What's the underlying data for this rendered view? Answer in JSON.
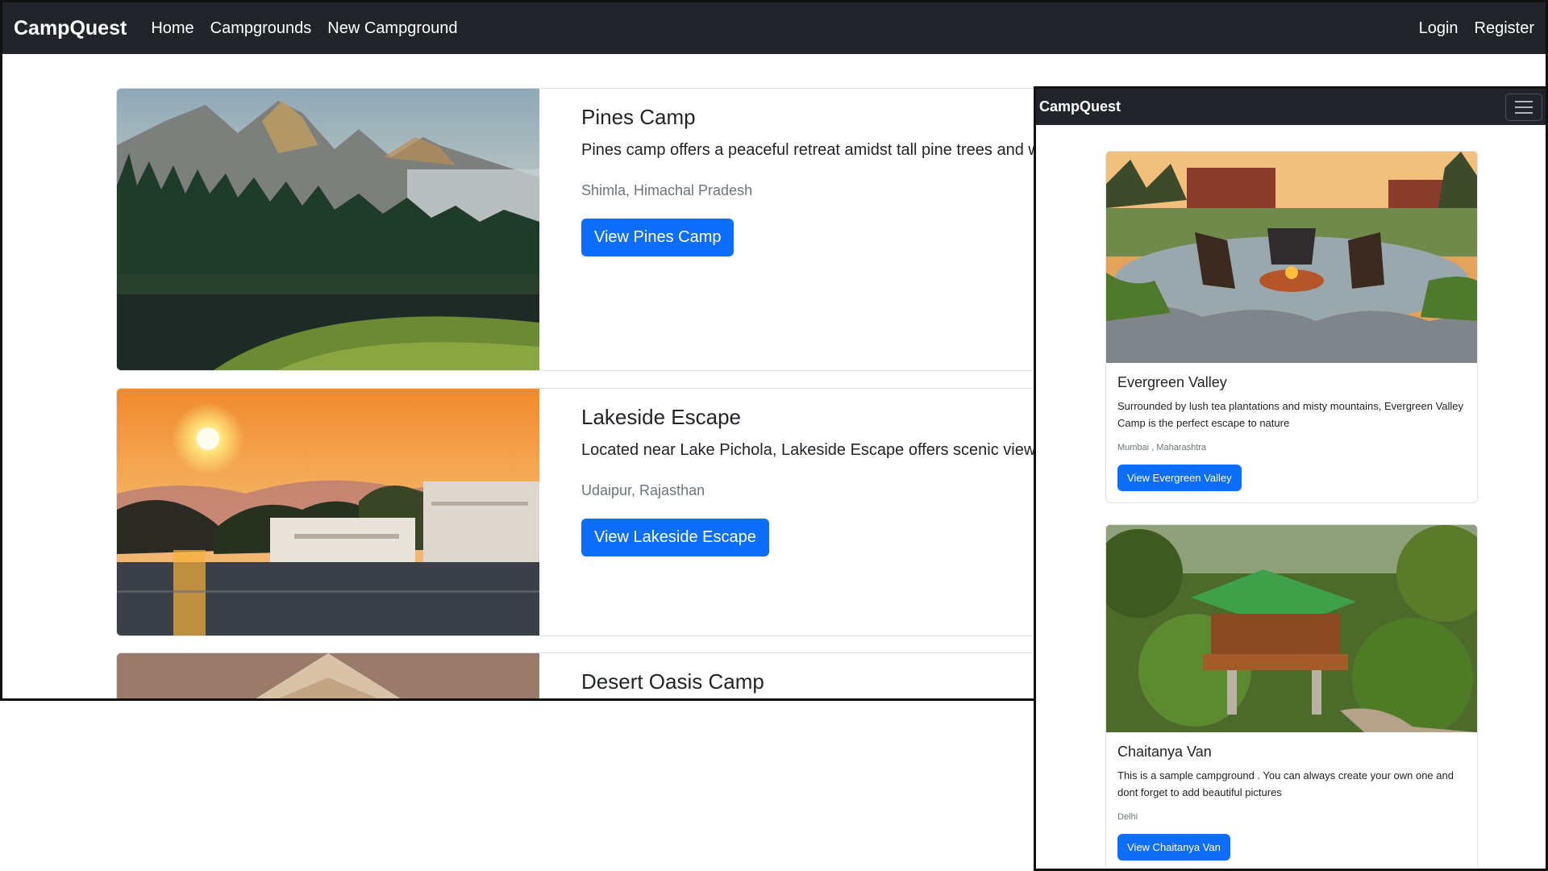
{
  "desktop": {
    "brand": "CampQuest",
    "nav": {
      "home": "Home",
      "campgrounds": "Campgrounds",
      "new": "New Campground",
      "login": "Login",
      "register": "Register"
    },
    "cards": [
      {
        "title": "Pines Camp",
        "description": "Pines camp offers a peaceful retreat amidst tall pine trees and w",
        "location": "Shimla, Himachal Pradesh",
        "button": "View Pines Camp"
      },
      {
        "title": "Lakeside Escape",
        "description": "Located near Lake Pichola, Lakeside Escape offers scenic views c",
        "location": "Udaipur, Rajasthan",
        "button": "View Lakeside Escape"
      },
      {
        "title": "Desert Oasis Camp"
      }
    ]
  },
  "mobile": {
    "brand": "CampQuest",
    "cards": [
      {
        "title": "Evergreen Valley",
        "description": "Surrounded by lush tea plantations and misty mountains, Evergreen Valley Camp is the perfect escape to nature",
        "location": "Mumbai , Maharashtra",
        "button": "View Evergreen Valley"
      },
      {
        "title": "Chaitanya Van",
        "description": "This is a sample campground . You can always create your own one and dont forget to add beautiful pictures",
        "location": "Delhi",
        "button": "View Chaitanya Van"
      }
    ]
  },
  "colors": {
    "navbar": "#212529",
    "primary": "#0d6efd",
    "muted": "#6c757d"
  },
  "icons": {
    "menu": "hamburger-menu-icon"
  }
}
